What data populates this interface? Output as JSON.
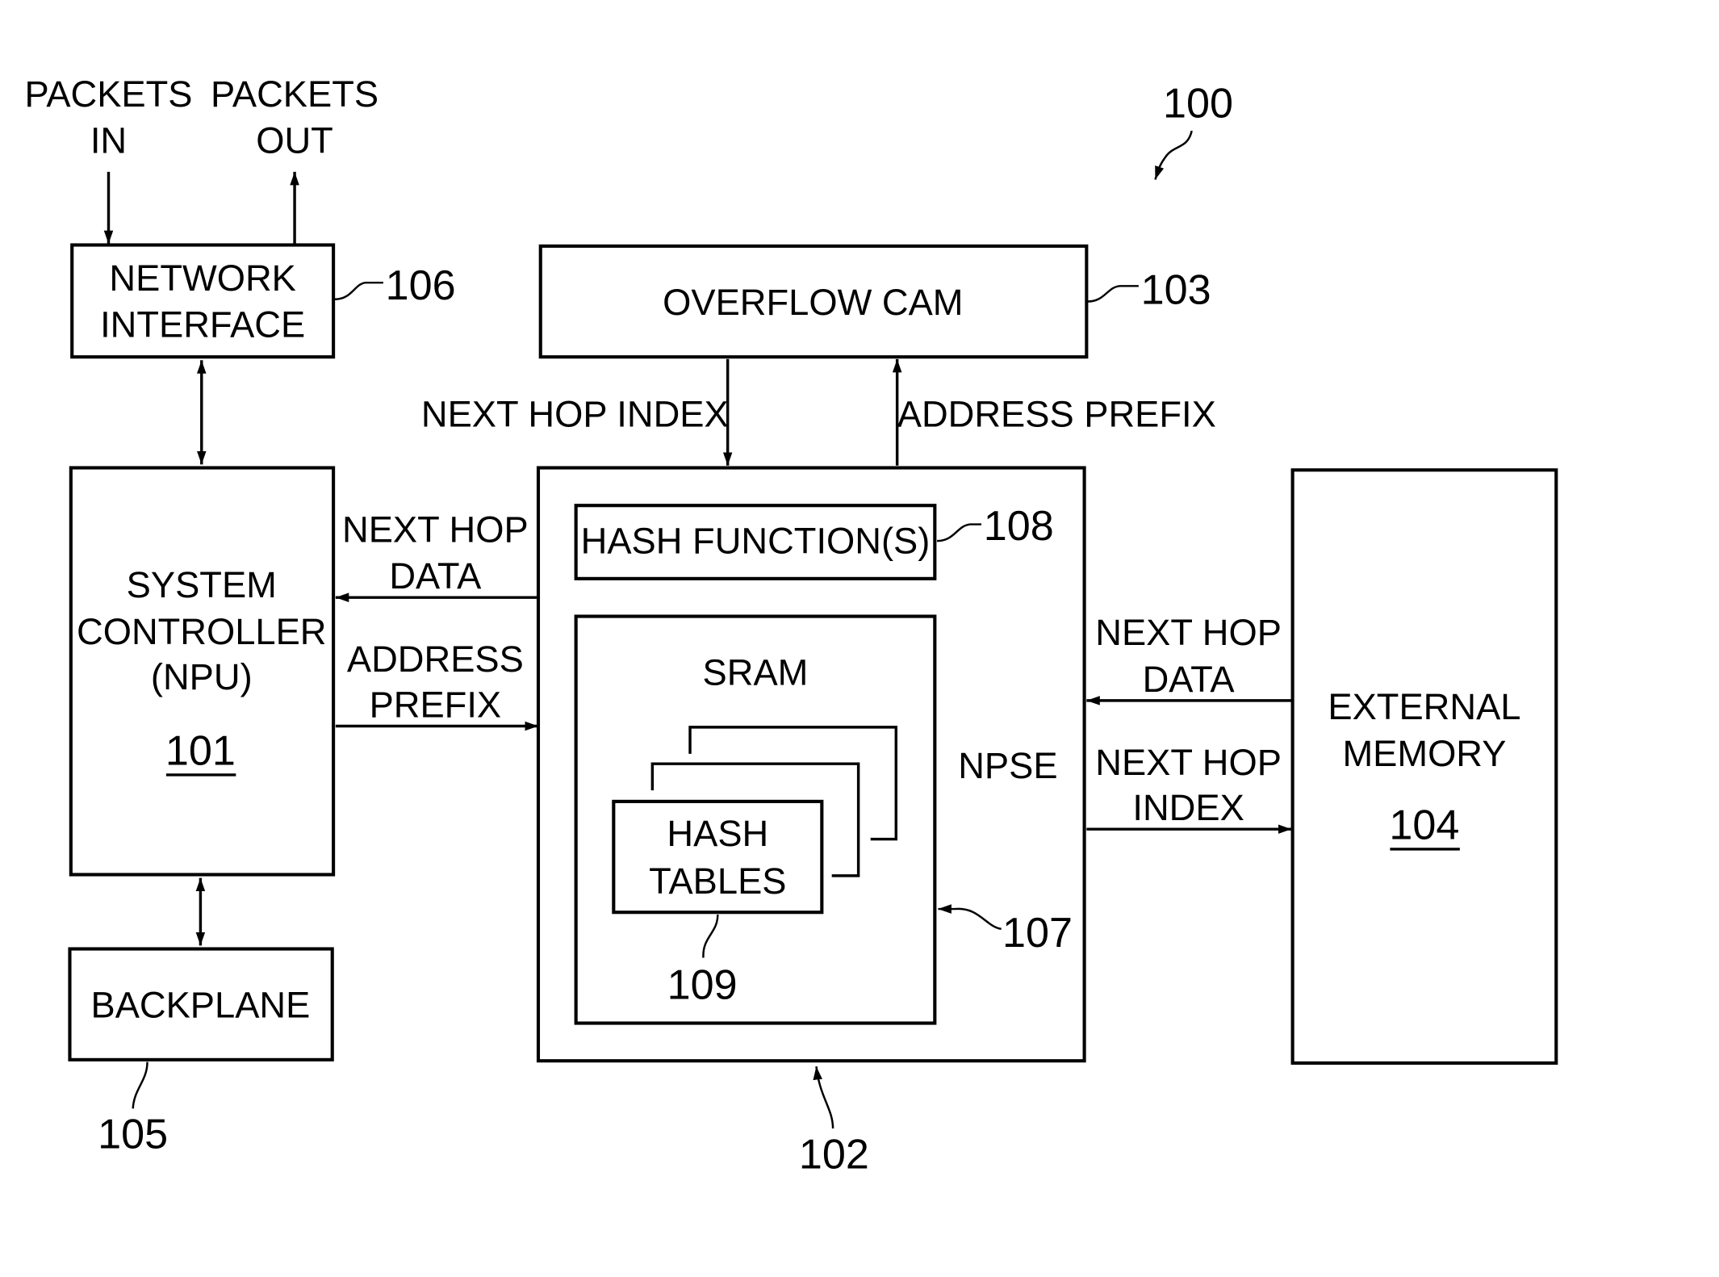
{
  "figure": {
    "ref_system": "100",
    "external_io": {
      "packets_in": [
        "PACKETS",
        "IN"
      ],
      "packets_out": [
        "PACKETS",
        "OUT"
      ]
    },
    "blocks": {
      "network_interface": {
        "lines": [
          "NETWORK",
          "INTERFACE"
        ],
        "ref": "106"
      },
      "system_controller": {
        "lines": [
          "SYSTEM",
          "CONTROLLER",
          "(NPU)"
        ],
        "ref": "101"
      },
      "backplane": {
        "lines": [
          "BACKPLANE"
        ],
        "ref": "105"
      },
      "overflow_cam": {
        "lines": [
          "OVERFLOW CAM"
        ],
        "ref": "103"
      },
      "npse": {
        "label": "NPSE",
        "ref": "102"
      },
      "hash_functions": {
        "lines": [
          "HASH FUNCTION(S)"
        ],
        "ref": "108"
      },
      "sram": {
        "label": "SRAM",
        "ref": "107"
      },
      "hash_tables": {
        "lines": [
          "HASH",
          "TABLES"
        ],
        "ref": "109"
      },
      "external_memory": {
        "lines": [
          "EXTERNAL",
          "MEMORY"
        ],
        "ref": "104"
      }
    },
    "signals": {
      "cam_next_hop_index": "NEXT HOP INDEX",
      "cam_address_prefix": "ADDRESS PREFIX",
      "ctrl_next_hop_data": [
        "NEXT HOP",
        "DATA"
      ],
      "ctrl_address_prefix": [
        "ADDRESS",
        "PREFIX"
      ],
      "ext_next_hop_data": [
        "NEXT HOP",
        "DATA"
      ],
      "ext_next_hop_index": [
        "NEXT HOP",
        "INDEX"
      ]
    }
  }
}
